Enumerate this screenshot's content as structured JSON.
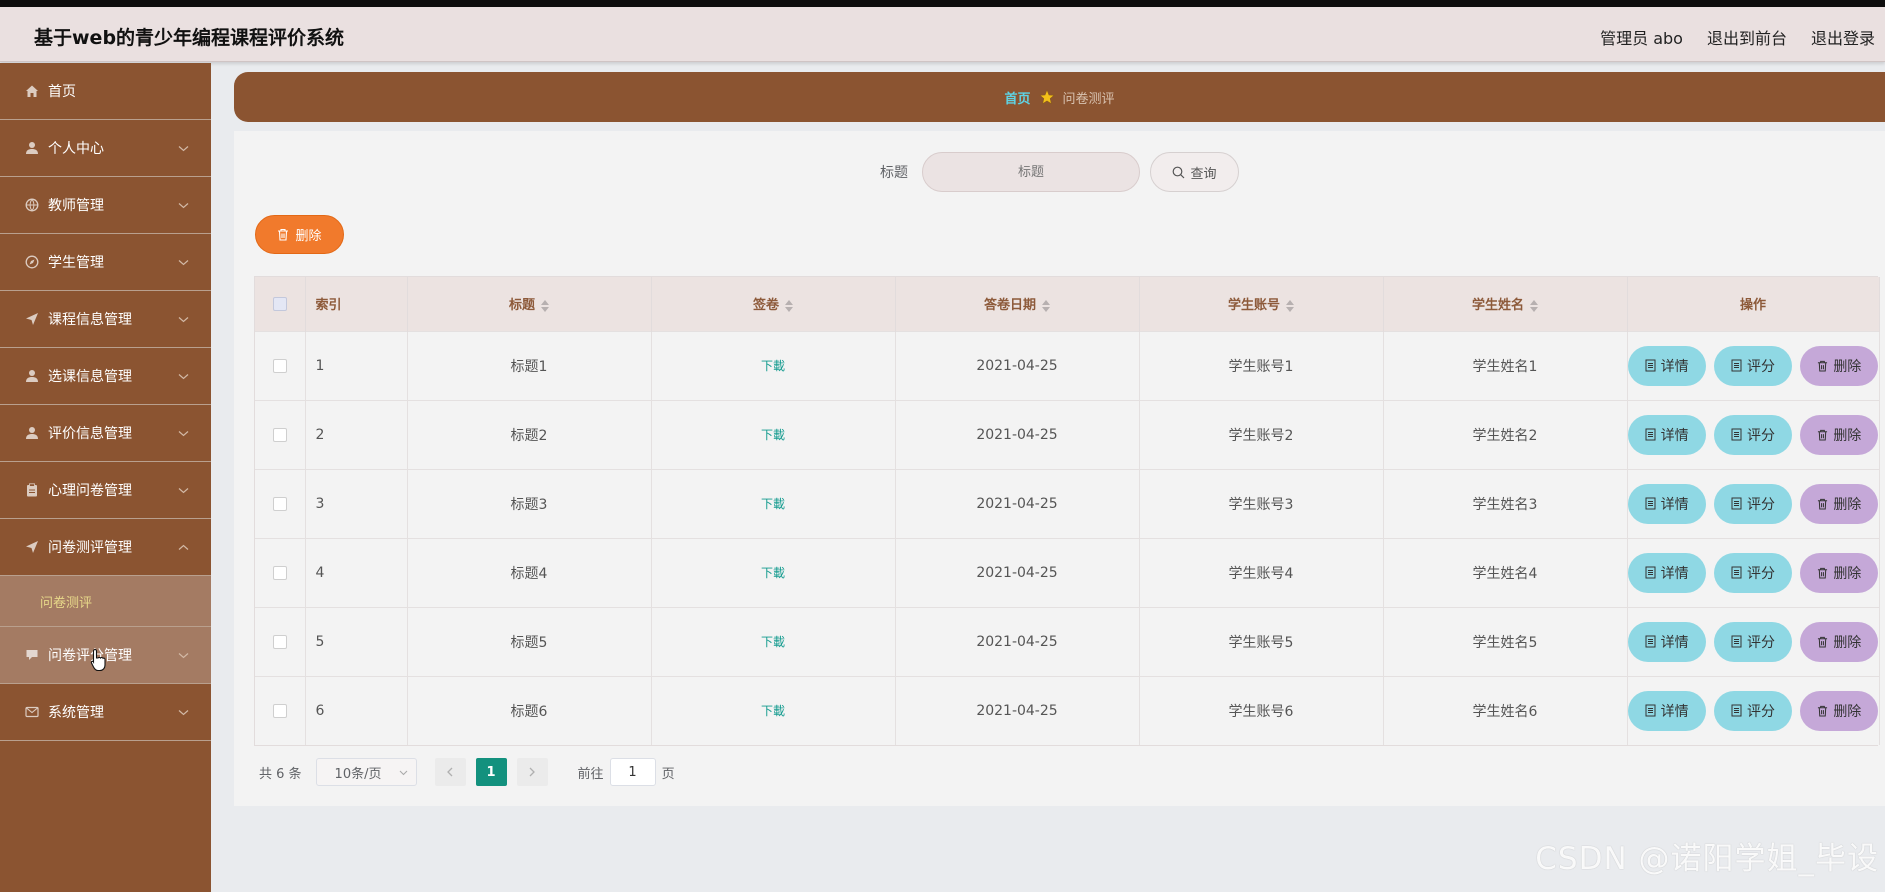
{
  "header": {
    "title": "基于web的青少年编程课程评价系统",
    "user": "管理员 abo",
    "front": "退出到前台",
    "logout": "退出登录"
  },
  "sidebar": {
    "items": [
      {
        "label": "首页",
        "icon": "home-icon"
      },
      {
        "label": "个人中心",
        "icon": "user-icon"
      },
      {
        "label": "教师管理",
        "icon": "globe-icon"
      },
      {
        "label": "学生管理",
        "icon": "compass-icon"
      },
      {
        "label": "课程信息管理",
        "icon": "send-icon"
      },
      {
        "label": "选课信息管理",
        "icon": "user-icon"
      },
      {
        "label": "评价信息管理",
        "icon": "user-icon"
      },
      {
        "label": "心理问卷管理",
        "icon": "clipboard-icon"
      },
      {
        "label": "问卷测评管理",
        "icon": "send-icon"
      },
      {
        "label": "问卷评分管理",
        "icon": "chat-icon"
      },
      {
        "label": "系统管理",
        "icon": "mail-icon"
      }
    ],
    "sub_item": "问卷测评"
  },
  "breadcrumb": {
    "home": "首页",
    "current": "问卷测评"
  },
  "search": {
    "label": "标题",
    "placeholder": "标题",
    "button": "查询"
  },
  "batch_delete": "删除",
  "table": {
    "headers": [
      "索引",
      "标题",
      "签卷",
      "答卷日期",
      "学生账号",
      "学生姓名",
      "操作"
    ],
    "rows": [
      {
        "index": "1",
        "title": "标题1",
        "file": "下載",
        "date": "2021-04-25",
        "account": "学生账号1",
        "name": "学生姓名1"
      },
      {
        "index": "2",
        "title": "标题2",
        "file": "下載",
        "date": "2021-04-25",
        "account": "学生账号2",
        "name": "学生姓名2"
      },
      {
        "index": "3",
        "title": "标题3",
        "file": "下載",
        "date": "2021-04-25",
        "account": "学生账号3",
        "name": "学生姓名3"
      },
      {
        "index": "4",
        "title": "标题4",
        "file": "下載",
        "date": "2021-04-25",
        "account": "学生账号4",
        "name": "学生姓名4"
      },
      {
        "index": "5",
        "title": "标题5",
        "file": "下載",
        "date": "2021-04-25",
        "account": "学生账号5",
        "name": "学生姓名5"
      },
      {
        "index": "6",
        "title": "标题6",
        "file": "下載",
        "date": "2021-04-25",
        "account": "学生账号6",
        "name": "学生姓名6"
      }
    ],
    "op_labels": {
      "detail": "详情",
      "score": "评分",
      "delete": "删除"
    }
  },
  "pagination": {
    "total": "共 6 条",
    "page_size": "10条/页",
    "current": "1",
    "jump_prefix": "前往",
    "jump_value": "1",
    "jump_suffix": "页"
  },
  "watermark": "CSDN @诺阳学姐_毕设",
  "colors": {
    "brand": "#8b5431",
    "accent": "#5fd3e4",
    "danger": "#f17a2c",
    "active_page": "#13917e"
  }
}
